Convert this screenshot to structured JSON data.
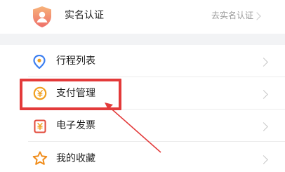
{
  "verification": {
    "title": "实名认证",
    "action_text": "去实名认证",
    "icon": "shield-check-icon"
  },
  "menu": {
    "items": [
      {
        "label": "行程列表",
        "icon": "location-pin-icon"
      },
      {
        "label": "支付管理",
        "icon": "yuan-coin-icon"
      },
      {
        "label": "电子发票",
        "icon": "invoice-icon"
      },
      {
        "label": "我的收藏",
        "icon": "star-icon"
      }
    ]
  },
  "colors": {
    "annotation_red": "#e33a3a",
    "shield_orange": "#f08a5d",
    "pin_blue": "#3d7ff0",
    "coin_orange": "#f0a020",
    "invoice_red": "#e24a3b",
    "star_orange": "#f08c1a",
    "separator_gray": "#f2f3f5"
  }
}
